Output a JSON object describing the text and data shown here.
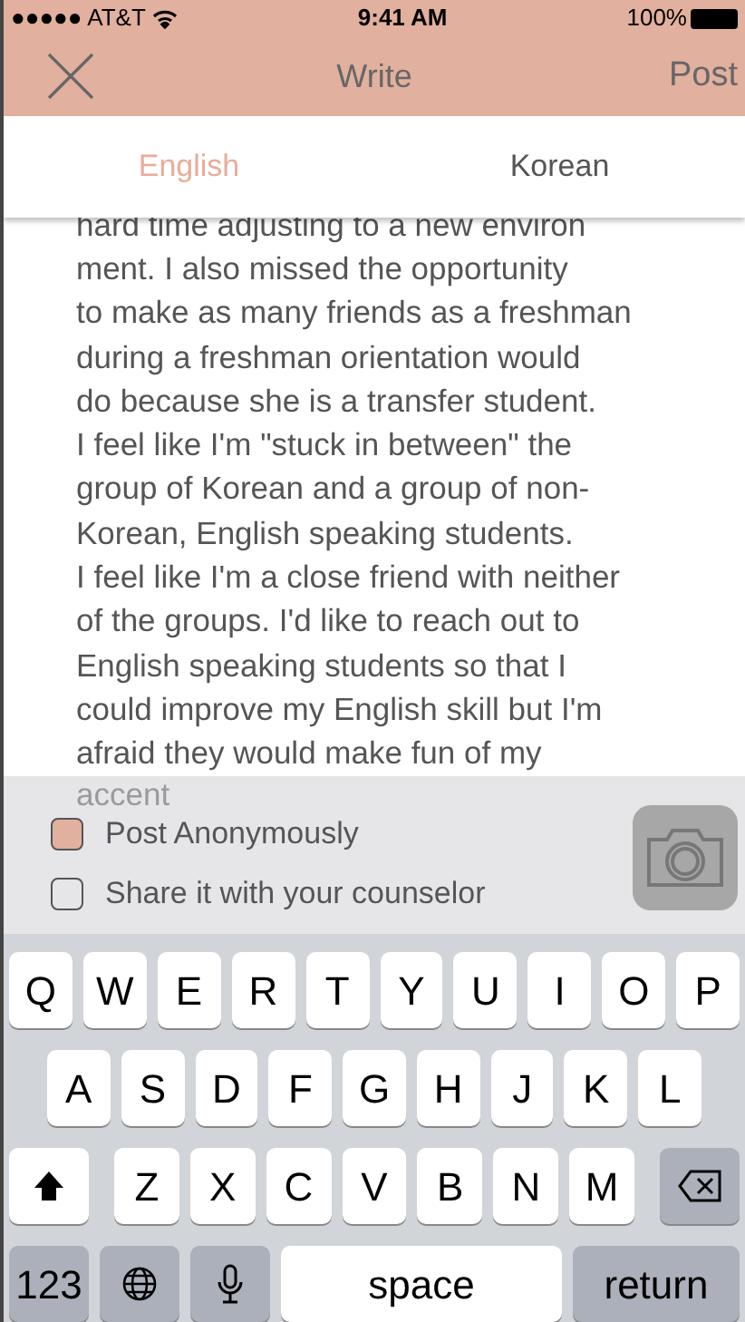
{
  "status_bar": {
    "carrier": "●●●●● AT&T",
    "time": "9:41 AM",
    "battery": "100%"
  },
  "nav": {
    "title": "Write",
    "action": "Post"
  },
  "tabs": [
    {
      "label": "English",
      "selected": true
    },
    {
      "label": "Korean",
      "selected": false
    }
  ],
  "body_lines": [
    "hard time adjusting to a new environ",
    "ment. I also missed the opportunity",
    "to make as many friends as a freshman",
    "during a freshman orientation would",
    "do because she is a transfer student.",
    "I feel like I'm \"stuck in between\" the",
    "group of Korean and a group of non-",
    "Korean, English speaking students.",
    "I feel like I'm a close friend with neither",
    "of the groups. I'd like to reach out to",
    "English speaking students so that I",
    "could improve my English skill but I'm",
    "afraid they would make fun of my"
  ],
  "hidden_line": "accent",
  "options": [
    {
      "label": "Post Anonymously",
      "checked": true
    },
    {
      "label": "Share it with your counselor",
      "checked": false
    }
  ],
  "keyboard": {
    "rows": [
      [
        "Q",
        "W",
        "E",
        "R",
        "T",
        "Y",
        "U",
        "I",
        "O",
        "P"
      ],
      [
        "A",
        "S",
        "D",
        "F",
        "G",
        "H",
        "J",
        "K",
        "L"
      ],
      [
        "Z",
        "X",
        "C",
        "V",
        "B",
        "N",
        "M"
      ]
    ],
    "numbers": "123",
    "space": "space",
    "return": "return"
  }
}
